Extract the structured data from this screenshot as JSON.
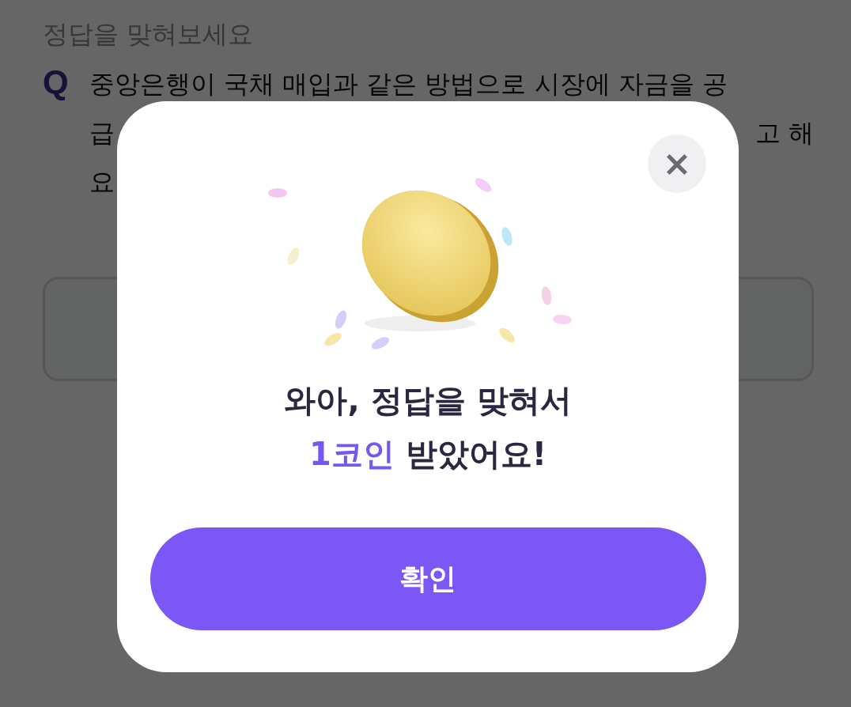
{
  "page": {
    "prompt": "정답을 맞혀보세요",
    "question_mark": "Q",
    "question_lines": [
      {
        "left": "중앙은행이 국채 매입과 같은 방법으로 시장에 자금을 공"
      },
      {
        "left": "급",
        "right": "고 해"
      },
      {
        "left": "요"
      }
    ]
  },
  "dialog": {
    "close": "×",
    "title": "와아, 정답을 맞혀서",
    "highlight": "1코인",
    "rest": "받았어요!",
    "button": "확인"
  }
}
